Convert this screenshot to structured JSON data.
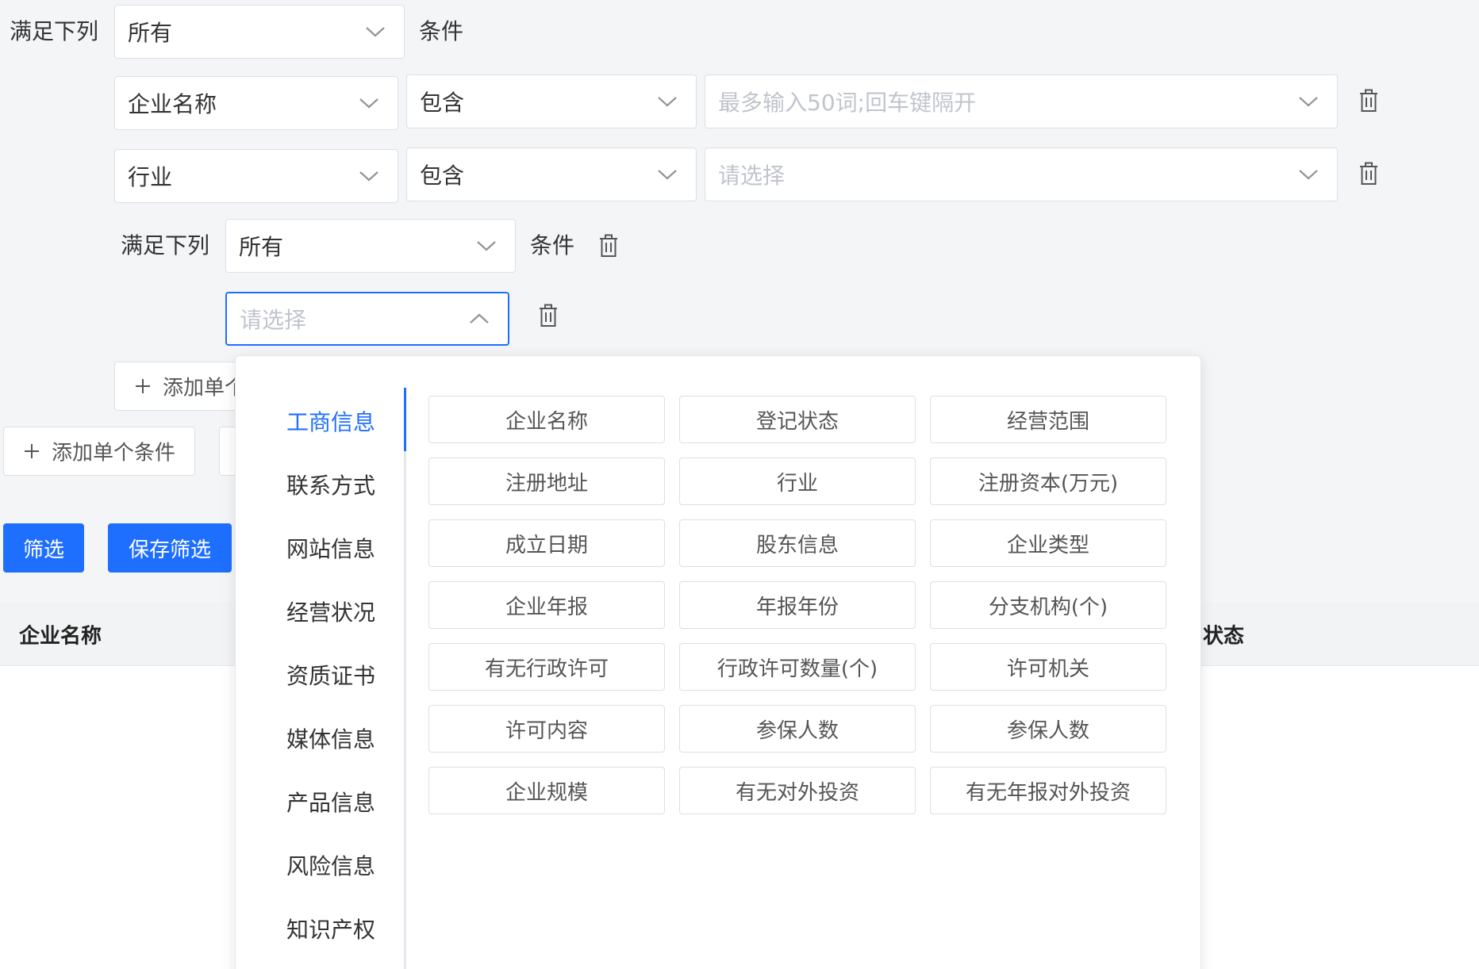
{
  "outer_group": {
    "prefix": "满足下列",
    "match_value": "所有",
    "suffix": "条件"
  },
  "rules": [
    {
      "field": "企业名称",
      "operator": "包含",
      "value_placeholder": "最多输入50词;回车键隔开"
    },
    {
      "field": "行业",
      "operator": "包含",
      "value_placeholder": "请选择"
    }
  ],
  "nested_group": {
    "prefix": "满足下列",
    "match_value": "所有",
    "suffix": "条件",
    "field_placeholder": "请选择",
    "add_condition_label": "添加单个条件"
  },
  "actions": {
    "add_condition_label": "添加单个条件",
    "filter_label": "筛选",
    "save_filter_label": "保存筛选"
  },
  "table": {
    "headers": [
      "企业名称",
      "状态"
    ]
  },
  "dropdown": {
    "categories": [
      "工商信息",
      "联系方式",
      "网站信息",
      "经营状况",
      "资质证书",
      "媒体信息",
      "产品信息",
      "风险信息",
      "知识产权"
    ],
    "active_category": "工商信息",
    "options": [
      "企业名称",
      "登记状态",
      "经营范围",
      "注册地址",
      "行业",
      "注册资本(万元)",
      "成立日期",
      "股东信息",
      "企业类型",
      "企业年报",
      "年报年份",
      "分支机构(个)",
      "有无行政许可",
      "行政许可数量(个)",
      "许可机关",
      "许可内容",
      "参保人数",
      "参保人数",
      "企业规模",
      "有无对外投资",
      "有无年报对外投资"
    ]
  },
  "colors": {
    "primary": "#1f6fff",
    "border": "#dcdfe6",
    "background": "#f4f5f7"
  }
}
